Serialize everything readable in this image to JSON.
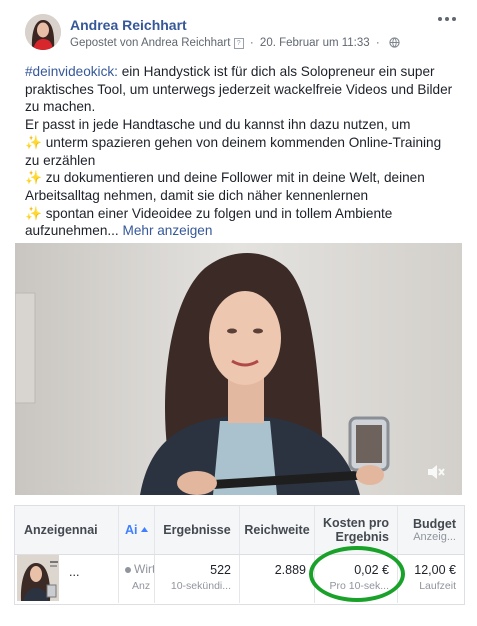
{
  "post": {
    "author": "Andrea Reichhart",
    "posted_by": "Gepostet von Andrea Reichhart",
    "help": "?",
    "date": "20. Februar um 11:33",
    "text": {
      "hashtag": "#deinvideokick:",
      "intro": " ein Handystick ist für dich als Solopreneur ein super praktisches Tool, um unterwegs jederzeit wackelfreie Videos und Bilder zu machen.",
      "line2": "Er passt in jede Handtasche und du kannst ihn dazu nutzen, um",
      "bullet1": " unterm spazieren gehen von deinem kommenden Online-Training zu erzählen",
      "bullet2": " zu dokumentieren und deine Follower mit in deine Welt, deinen Arbeitsalltag nehmen, damit sie dich näher kennenlernen",
      "bullet3": " spontan einer Videoidee zu folgen und in tollem Ambiente aufzunehmen...",
      "sparkle": "✨",
      "see_more": "Mehr anzeigen"
    },
    "icons": {
      "options": "more-options-icon",
      "privacy": "globe-icon",
      "mute": "mute-icon"
    }
  },
  "ads_table": {
    "headers": {
      "name": "Anzeigennai",
      "status": "Ai",
      "results": "Ergebnisse",
      "reach": "Reichweite",
      "cost": "Kosten pro Ergebnis",
      "budget": "Budget",
      "budget_sub": "Anzeig..."
    },
    "row": {
      "name": "...",
      "status": "Wirt",
      "status_sub": "Anz",
      "results": "522",
      "results_sub": "10-sekündi...",
      "reach": "2.889",
      "cost": "0,02 €",
      "cost_sub": "Pro 10-sek...",
      "budget": "12,00 €",
      "budget_sub": "Laufzeit"
    }
  },
  "colors": {
    "link": "#365899",
    "annotation_circle": "#1aa12a",
    "sort_accent": "#4080ff"
  }
}
